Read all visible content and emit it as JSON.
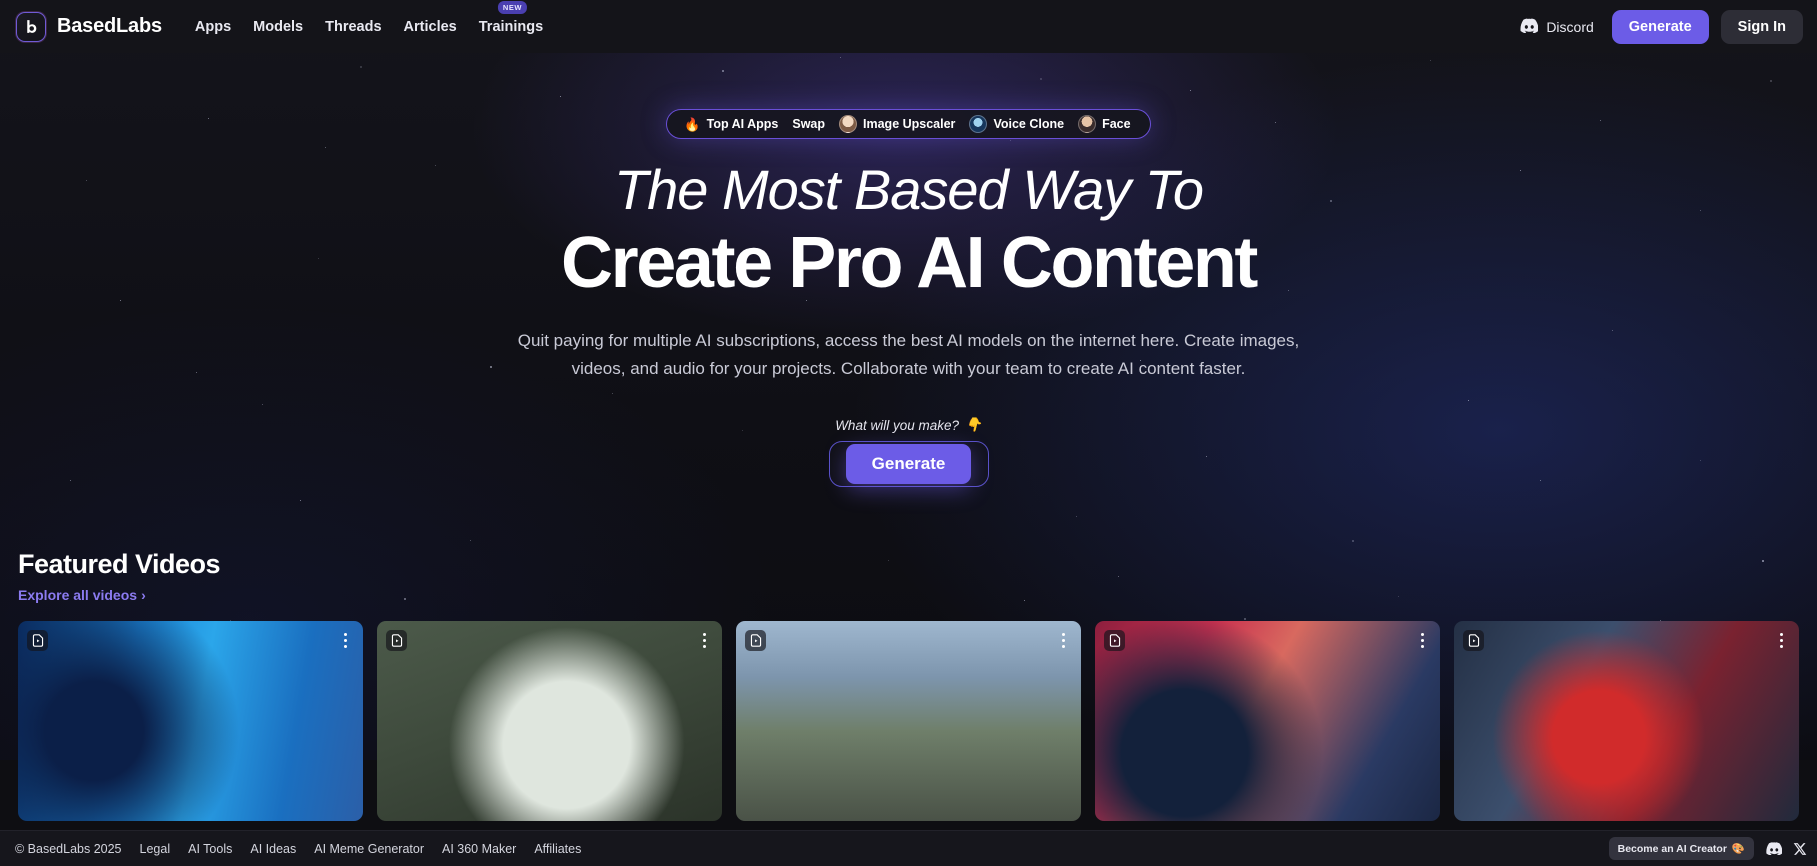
{
  "navbar": {
    "brand": "BasedLabs",
    "logo_icon": "basedlabs-logo-icon",
    "links": [
      {
        "label": "Apps",
        "badge": ""
      },
      {
        "label": "Models",
        "badge": ""
      },
      {
        "label": "Threads",
        "badge": ""
      },
      {
        "label": "Articles",
        "badge": ""
      },
      {
        "label": "Trainings",
        "badge": "NEW"
      }
    ],
    "discord_label": "Discord",
    "generate_label": "Generate",
    "signin_label": "Sign In"
  },
  "hero": {
    "pill": {
      "items": [
        {
          "emoji": "🔥",
          "label": "Top AI Apps",
          "avatar": ""
        },
        {
          "emoji": "",
          "label": "Swap",
          "avatar": ""
        },
        {
          "emoji": "",
          "label": "Image Upscaler",
          "avatar": "av1"
        },
        {
          "emoji": "",
          "label": "Voice Clone",
          "avatar": "av2"
        },
        {
          "emoji": "",
          "label": "Face",
          "avatar": "av3"
        }
      ]
    },
    "headline_line1": "The Most Based Way To",
    "headline_line2": "Create Pro AI Content",
    "subtitle": "Quit paying for multiple AI subscriptions, access the best AI models on the internet here. Create images, videos, and audio for your projects. Collaborate with your team to create AI content faster.",
    "make_label": "What will you make?",
    "make_emoji": "👇",
    "generate_label": "Generate"
  },
  "featured": {
    "title": "Featured Videos",
    "explore_label": "Explore all videos",
    "explore_chevron": "›",
    "cards": [
      {
        "thumb": "thumb1",
        "badge_icon": "video-file-icon",
        "menu_icon": "kebab-menu-icon"
      },
      {
        "thumb": "thumb2",
        "badge_icon": "video-file-icon",
        "menu_icon": "kebab-menu-icon"
      },
      {
        "thumb": "thumb3",
        "badge_icon": "video-file-icon",
        "menu_icon": "kebab-menu-icon"
      },
      {
        "thumb": "thumb4",
        "badge_icon": "video-file-icon",
        "menu_icon": "kebab-menu-icon"
      },
      {
        "thumb": "thumb5",
        "badge_icon": "video-file-icon",
        "menu_icon": "kebab-menu-icon"
      }
    ]
  },
  "footer": {
    "copyright": "© BasedLabs 2025",
    "links": [
      "Legal",
      "AI Tools",
      "AI Ideas",
      "AI Meme Generator",
      "AI 360 Maker",
      "Affiliates"
    ],
    "creator_label": "Become an AI Creator",
    "creator_emoji": "🎨",
    "discord_icon": "discord-icon",
    "x_icon": "x-twitter-icon"
  },
  "colors": {
    "accent": "#6c5ce7",
    "pill_border": "#6a4fd8",
    "link": "#8b7bf0",
    "bg": "#0e0e12",
    "nav_bg": "#141419"
  }
}
